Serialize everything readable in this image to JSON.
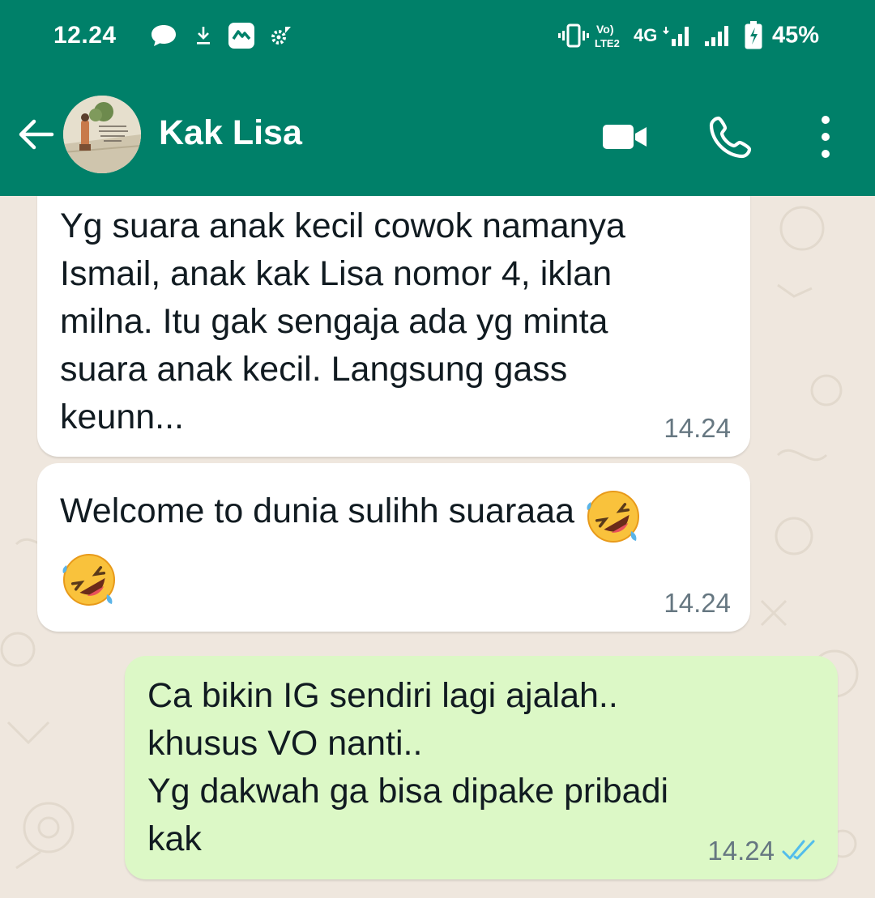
{
  "status_bar": {
    "time": "12.24",
    "network": "4G",
    "battery": "45%",
    "icons": [
      "chat-bubble-icon",
      "download-icon",
      "app-icon",
      "gear-icon",
      "vibrate-icon",
      "volte-icon",
      "signal-icon",
      "signal-icon",
      "battery-icon"
    ]
  },
  "header": {
    "contact_name": "Kak Lisa",
    "icons": [
      "back-arrow-icon",
      "video-call-icon",
      "phone-icon",
      "more-vert-icon"
    ]
  },
  "messages": [
    {
      "direction": "incoming",
      "text": "Yg suara anak kecil cowok namanya\nIsmail, anak kak Lisa nomor 4, iklan\nmilna. Itu gak sengaja ada yg minta\nsuara anak kecil. Langsung gass\nkeunn...",
      "time": "14.24"
    },
    {
      "direction": "incoming",
      "text": "Welcome to dunia sulihh suaraaa",
      "emoji": "rolling-on-floor-laughing",
      "time": "14.24"
    },
    {
      "direction": "outgoing",
      "text": "Ca bikin IG sendiri lagi ajalah..\nkhusus VO nanti..\nYg dakwah ga bisa dipake pribadi\nkak",
      "time": "14.24",
      "status": "read"
    }
  ],
  "colors": {
    "header_green": "#008069",
    "chat_background": "#efe7de",
    "incoming_bubble": "#ffffff",
    "outgoing_bubble": "#dcf8c6",
    "read_tick": "#53bdeb",
    "timestamp": "#667781"
  }
}
